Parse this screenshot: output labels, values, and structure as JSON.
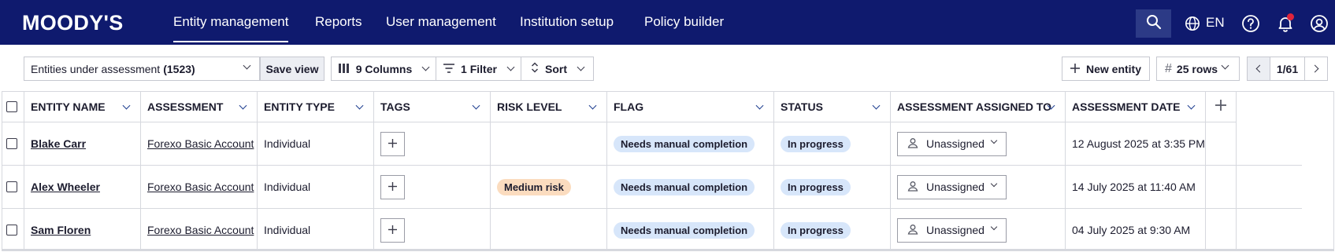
{
  "brand": {
    "logo": "MOODY'S"
  },
  "nav": {
    "items": [
      {
        "label": "Entity management",
        "active": true
      },
      {
        "label": "Reports"
      },
      {
        "label": "User management"
      },
      {
        "label": "Institution setup"
      },
      {
        "label": "Policy builder"
      }
    ],
    "language": "EN",
    "icons": [
      "search-icon",
      "globe-icon",
      "help-icon",
      "bell-icon",
      "user-icon"
    ]
  },
  "toolbar": {
    "view_label": "Entities under assessment",
    "view_count": "(1523)",
    "save_view": "Save view",
    "columns": "9 Columns",
    "filter": "1 Filter",
    "sort": "Sort",
    "new_entity": "New entity",
    "rows_hash": "#",
    "rows": "25 rows",
    "page": "1/61"
  },
  "table": {
    "headers": [
      "ENTITY NAME",
      "ASSESSMENT",
      "ENTITY TYPE",
      "TAGS",
      "RISK LEVEL",
      "FLAG",
      "STATUS",
      "ASSESSMENT ASSIGNED TO",
      "ASSESSMENT DATE"
    ],
    "rows": [
      {
        "name": "Blake Carr",
        "assessment": "Forexo Basic Account",
        "type": "Individual",
        "risk": "",
        "flag": "Needs manual completion",
        "status": "In progress",
        "assigned": "Unassigned",
        "date": "12 August 2025 at 3:35 PM"
      },
      {
        "name": "Alex Wheeler",
        "assessment": "Forexo Basic Account",
        "type": "Individual",
        "risk": "Medium risk",
        "flag": "Needs manual completion",
        "status": "In progress",
        "assigned": "Unassigned",
        "date": "14 July 2025 at 11:40 AM"
      },
      {
        "name": "Sam Floren",
        "assessment": "Forexo Basic Account",
        "type": "Individual",
        "risk": "",
        "flag": "Needs manual completion",
        "status": "In progress",
        "assigned": "Unassigned",
        "date": "04 July 2025 at 9:30 AM"
      }
    ]
  },
  "colors": {
    "nav_bg": "#0f1a6e",
    "pill_blue": "#d7e6fa",
    "pill_orange": "#fbdcbf",
    "notification_dot": "#e0243c"
  }
}
